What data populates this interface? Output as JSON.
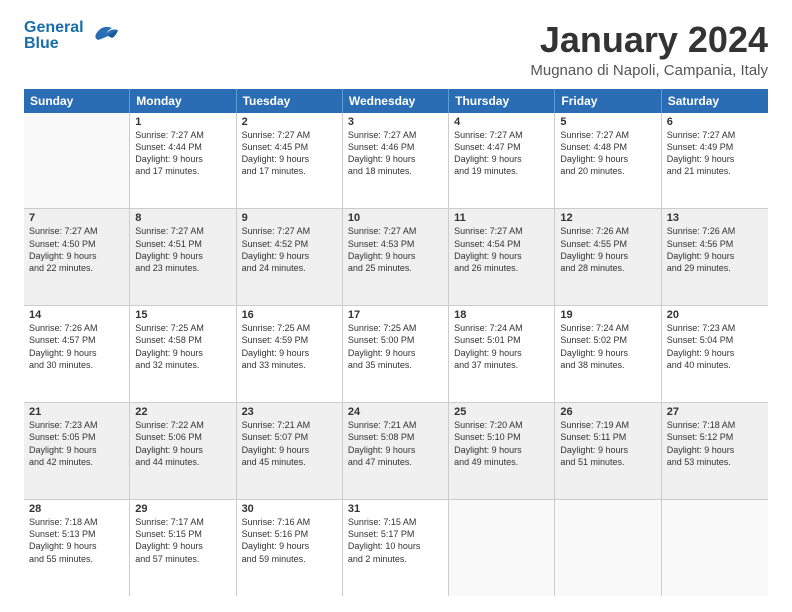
{
  "header": {
    "logo_line1": "General",
    "logo_line2": "Blue",
    "month": "January 2024",
    "location": "Mugnano di Napoli, Campania, Italy"
  },
  "days_of_week": [
    "Sunday",
    "Monday",
    "Tuesday",
    "Wednesday",
    "Thursday",
    "Friday",
    "Saturday"
  ],
  "weeks": [
    [
      {
        "day": "",
        "info": ""
      },
      {
        "day": "1",
        "info": "Sunrise: 7:27 AM\nSunset: 4:44 PM\nDaylight: 9 hours\nand 17 minutes."
      },
      {
        "day": "2",
        "info": "Sunrise: 7:27 AM\nSunset: 4:45 PM\nDaylight: 9 hours\nand 17 minutes."
      },
      {
        "day": "3",
        "info": "Sunrise: 7:27 AM\nSunset: 4:46 PM\nDaylight: 9 hours\nand 18 minutes."
      },
      {
        "day": "4",
        "info": "Sunrise: 7:27 AM\nSunset: 4:47 PM\nDaylight: 9 hours\nand 19 minutes."
      },
      {
        "day": "5",
        "info": "Sunrise: 7:27 AM\nSunset: 4:48 PM\nDaylight: 9 hours\nand 20 minutes."
      },
      {
        "day": "6",
        "info": "Sunrise: 7:27 AM\nSunset: 4:49 PM\nDaylight: 9 hours\nand 21 minutes."
      }
    ],
    [
      {
        "day": "7",
        "info": "Sunrise: 7:27 AM\nSunset: 4:50 PM\nDaylight: 9 hours\nand 22 minutes."
      },
      {
        "day": "8",
        "info": "Sunrise: 7:27 AM\nSunset: 4:51 PM\nDaylight: 9 hours\nand 23 minutes."
      },
      {
        "day": "9",
        "info": "Sunrise: 7:27 AM\nSunset: 4:52 PM\nDaylight: 9 hours\nand 24 minutes."
      },
      {
        "day": "10",
        "info": "Sunrise: 7:27 AM\nSunset: 4:53 PM\nDaylight: 9 hours\nand 25 minutes."
      },
      {
        "day": "11",
        "info": "Sunrise: 7:27 AM\nSunset: 4:54 PM\nDaylight: 9 hours\nand 26 minutes."
      },
      {
        "day": "12",
        "info": "Sunrise: 7:26 AM\nSunset: 4:55 PM\nDaylight: 9 hours\nand 28 minutes."
      },
      {
        "day": "13",
        "info": "Sunrise: 7:26 AM\nSunset: 4:56 PM\nDaylight: 9 hours\nand 29 minutes."
      }
    ],
    [
      {
        "day": "14",
        "info": "Sunrise: 7:26 AM\nSunset: 4:57 PM\nDaylight: 9 hours\nand 30 minutes."
      },
      {
        "day": "15",
        "info": "Sunrise: 7:25 AM\nSunset: 4:58 PM\nDaylight: 9 hours\nand 32 minutes."
      },
      {
        "day": "16",
        "info": "Sunrise: 7:25 AM\nSunset: 4:59 PM\nDaylight: 9 hours\nand 33 minutes."
      },
      {
        "day": "17",
        "info": "Sunrise: 7:25 AM\nSunset: 5:00 PM\nDaylight: 9 hours\nand 35 minutes."
      },
      {
        "day": "18",
        "info": "Sunrise: 7:24 AM\nSunset: 5:01 PM\nDaylight: 9 hours\nand 37 minutes."
      },
      {
        "day": "19",
        "info": "Sunrise: 7:24 AM\nSunset: 5:02 PM\nDaylight: 9 hours\nand 38 minutes."
      },
      {
        "day": "20",
        "info": "Sunrise: 7:23 AM\nSunset: 5:04 PM\nDaylight: 9 hours\nand 40 minutes."
      }
    ],
    [
      {
        "day": "21",
        "info": "Sunrise: 7:23 AM\nSunset: 5:05 PM\nDaylight: 9 hours\nand 42 minutes."
      },
      {
        "day": "22",
        "info": "Sunrise: 7:22 AM\nSunset: 5:06 PM\nDaylight: 9 hours\nand 44 minutes."
      },
      {
        "day": "23",
        "info": "Sunrise: 7:21 AM\nSunset: 5:07 PM\nDaylight: 9 hours\nand 45 minutes."
      },
      {
        "day": "24",
        "info": "Sunrise: 7:21 AM\nSunset: 5:08 PM\nDaylight: 9 hours\nand 47 minutes."
      },
      {
        "day": "25",
        "info": "Sunrise: 7:20 AM\nSunset: 5:10 PM\nDaylight: 9 hours\nand 49 minutes."
      },
      {
        "day": "26",
        "info": "Sunrise: 7:19 AM\nSunset: 5:11 PM\nDaylight: 9 hours\nand 51 minutes."
      },
      {
        "day": "27",
        "info": "Sunrise: 7:18 AM\nSunset: 5:12 PM\nDaylight: 9 hours\nand 53 minutes."
      }
    ],
    [
      {
        "day": "28",
        "info": "Sunrise: 7:18 AM\nSunset: 5:13 PM\nDaylight: 9 hours\nand 55 minutes."
      },
      {
        "day": "29",
        "info": "Sunrise: 7:17 AM\nSunset: 5:15 PM\nDaylight: 9 hours\nand 57 minutes."
      },
      {
        "day": "30",
        "info": "Sunrise: 7:16 AM\nSunset: 5:16 PM\nDaylight: 9 hours\nand 59 minutes."
      },
      {
        "day": "31",
        "info": "Sunrise: 7:15 AM\nSunset: 5:17 PM\nDaylight: 10 hours\nand 2 minutes."
      },
      {
        "day": "",
        "info": ""
      },
      {
        "day": "",
        "info": ""
      },
      {
        "day": "",
        "info": ""
      }
    ]
  ]
}
